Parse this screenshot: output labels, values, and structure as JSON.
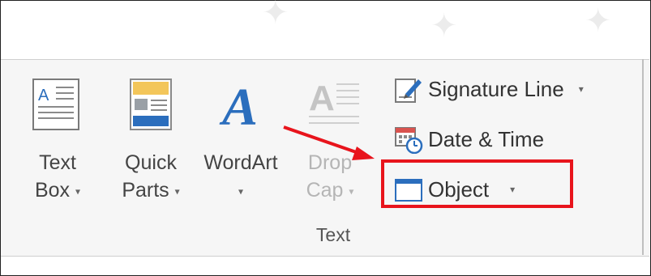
{
  "ribbon": {
    "group_label": "Text",
    "buttons": [
      {
        "id": "text-box",
        "line1": "Text",
        "line2": "Box",
        "has_caret": true,
        "icon": "text-box-icon"
      },
      {
        "id": "quick-parts",
        "line1": "Quick",
        "line2": "Parts",
        "has_caret": true,
        "icon": "quick-parts-icon"
      },
      {
        "id": "wordart",
        "line1": "WordArt",
        "line2": "",
        "has_caret": true,
        "icon": "wordart-icon"
      },
      {
        "id": "drop-cap",
        "line1": "Drop",
        "line2": "Cap",
        "has_caret": true,
        "disabled": true,
        "icon": "drop-cap-icon"
      }
    ],
    "small_buttons": [
      {
        "id": "signature-line",
        "label": "Signature Line",
        "has_caret": true,
        "icon": "signature-line-icon"
      },
      {
        "id": "date-time",
        "label": "Date & Time",
        "has_caret": false,
        "icon": "date-time-icon"
      },
      {
        "id": "object",
        "label": "Object",
        "has_caret": true,
        "icon": "object-icon"
      }
    ],
    "caret_glyph": "▾"
  },
  "annotation": {
    "arrow_color": "#e8141c",
    "highlight_color": "#e8141c"
  }
}
